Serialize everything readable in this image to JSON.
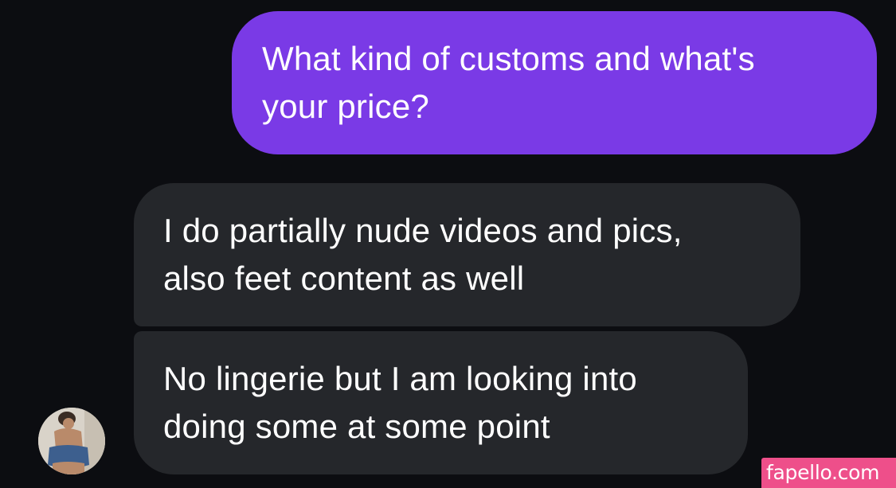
{
  "conversation": {
    "messages": [
      {
        "sender": "me",
        "text": "What kind of customs and what's\nyour price?"
      },
      {
        "sender": "contact",
        "text": "I do partially nude videos and pics,\nalso feet content as well"
      },
      {
        "sender": "contact",
        "text": "No lingerie but I am looking into\ndoing some at some point"
      }
    ],
    "sent_bubble_color": "#7a3ae6",
    "received_bubble_color": "#25272b",
    "background_color": "#0c0d11"
  },
  "contact": {
    "avatar": "contact-photo"
  },
  "watermark": {
    "text": "fapello.com",
    "color": "#ee4f8a"
  }
}
